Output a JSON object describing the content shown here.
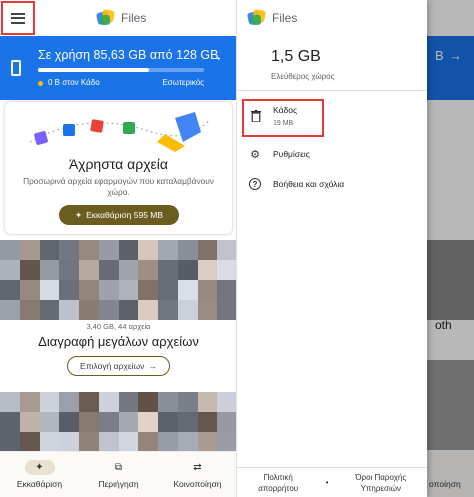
{
  "app": {
    "title": "Files"
  },
  "storage": {
    "usage_text": "Σε χρήση 85,63 GB από 128 GB",
    "used_fraction": 0.669,
    "trash_text": "0 B στον Κάδο",
    "internal_label": "Εσωτερικός"
  },
  "junk_card": {
    "title": "Άχρηστα αρχεία",
    "description": "Προσωρινά αρχεία εφαρμογών που καταλαμβάνουν χώρο.",
    "button_label": "Εκκαθάριση 595 MB"
  },
  "large_files_card": {
    "info": "3,40 GB, 44 αρχεία",
    "title": "Διαγραφή μεγάλων αρχείων",
    "button_label": "Επιλογή αρχείων"
  },
  "bottom_nav": [
    {
      "label": "Εκκαθάριση",
      "icon": "sparkle-icon",
      "active": true
    },
    {
      "label": "Περιήγηση",
      "icon": "browse-icon",
      "active": false
    },
    {
      "label": "Κοινοποίηση",
      "icon": "swap-icon",
      "active": false
    }
  ],
  "drawer": {
    "title": "Files",
    "free_size": "1,5 GB",
    "free_label": "Ελεύθερος χώρος",
    "trash": {
      "label": "Κάδος",
      "size": "19 MB"
    },
    "items": [
      {
        "label": "Ρυθμίσεις",
        "icon": "gear-icon"
      },
      {
        "label": "Βοήθεια και σχόλια",
        "icon": "help-icon"
      }
    ],
    "footer": {
      "privacy": "Πολιτική απορρήτου",
      "separator": "•",
      "terms": "Όροι Παροχής Υπηρεσιών"
    }
  },
  "background_peek": {
    "size_text": "B",
    "arrow": "→",
    "bottom_label": "οποίηση",
    "snippet": "oth"
  },
  "colors": {
    "accent_blue": "#1a73e8",
    "highlight_red": "#e53935",
    "button_olive": "#6b5d1f"
  }
}
